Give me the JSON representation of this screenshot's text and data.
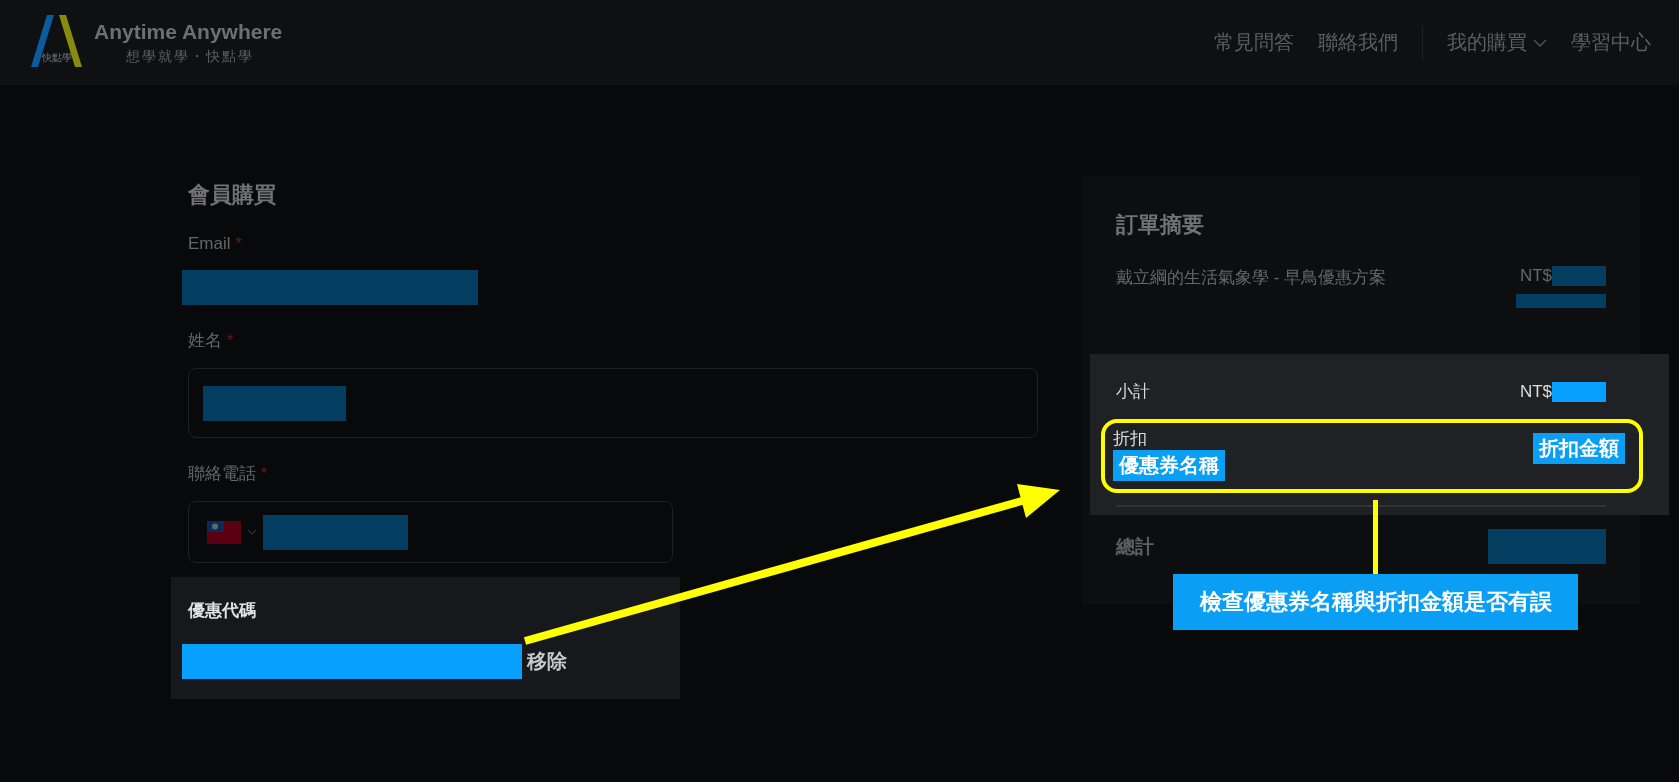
{
  "header": {
    "logo": {
      "title": "Anytime Anywhere",
      "tagline": "想學就學・快點學",
      "mark_text": "快點學"
    },
    "nav": [
      {
        "label": "常見問答",
        "kind": "link"
      },
      {
        "label": "聯絡我們",
        "kind": "link"
      },
      {
        "label": "我的購買",
        "kind": "dropdown"
      },
      {
        "label": "學習中心",
        "kind": "link"
      }
    ]
  },
  "form": {
    "title": "會員購買",
    "fields": [
      {
        "label": "Email",
        "required_mark": "*",
        "kind": "plain"
      },
      {
        "label": "姓名",
        "required_mark": "*",
        "kind": "boxed"
      },
      {
        "label": "聯絡電話",
        "required_mark": "*",
        "kind": "phone"
      }
    ]
  },
  "coupon": {
    "title": "優惠代碼",
    "action": "移除"
  },
  "summary": {
    "title": "訂單摘要",
    "items": [
      {
        "name": "戴立綱的生活氣象學 - 早鳥優惠方案",
        "currency": "NT$"
      }
    ],
    "subtotal": {
      "label": "小計",
      "currency": "NT$"
    },
    "discount": {
      "label": "折扣",
      "coupon_label": "優惠券名稱",
      "amount_label": "折扣金額"
    },
    "total": {
      "label": "總計"
    }
  },
  "annotation": {
    "callout": "檢查優惠券名稱與折扣金額是否有誤"
  }
}
